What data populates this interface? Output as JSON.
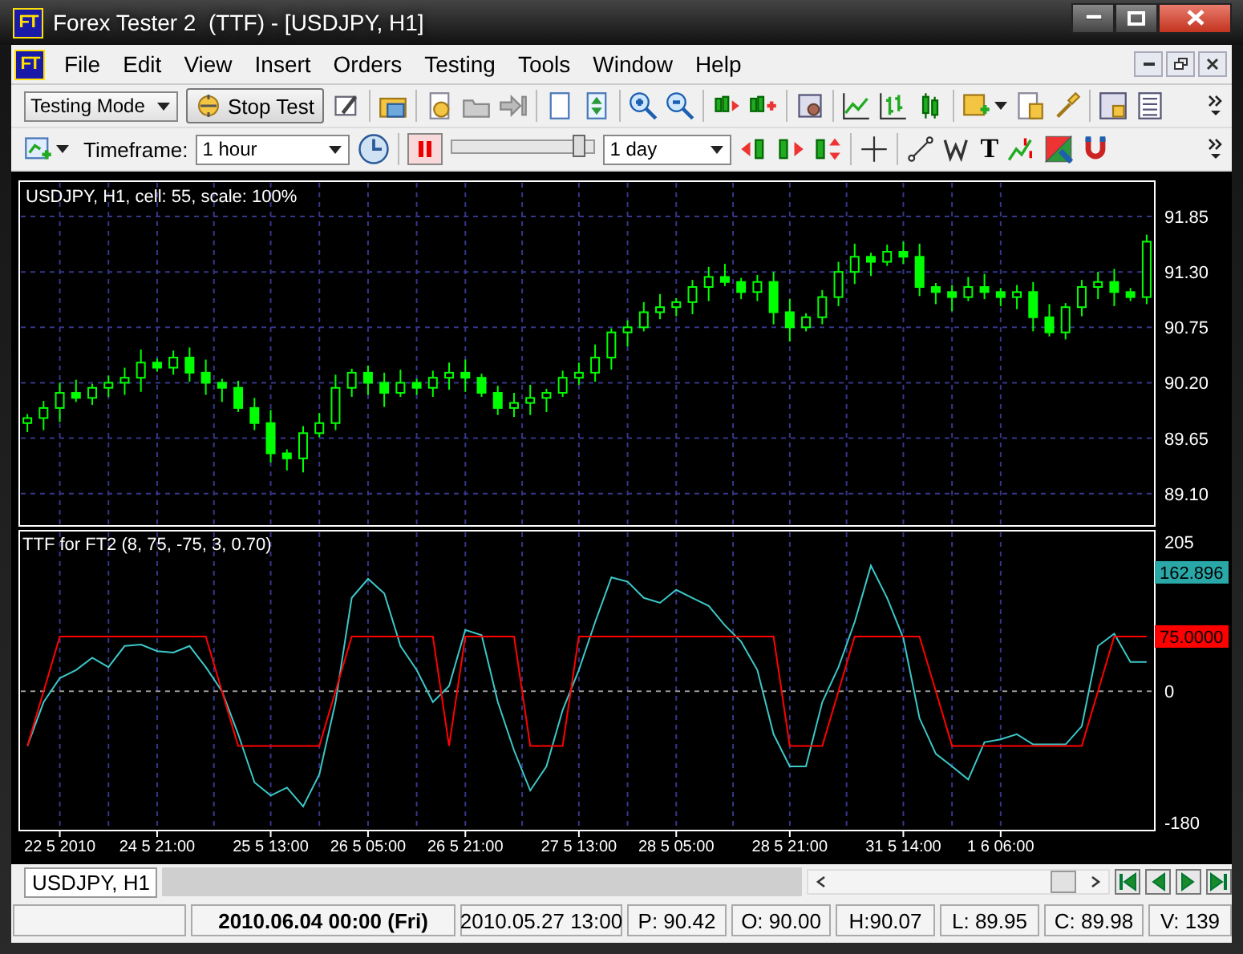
{
  "title_bar": {
    "logo": "FT",
    "title": "Forex Tester 2  (TTF) - [USDJPY, H1]"
  },
  "menu_bar": {
    "logo": "FT",
    "items": [
      "File",
      "Edit",
      "View",
      "Insert",
      "Orders",
      "Testing",
      "Tools",
      "Window",
      "Help"
    ]
  },
  "toolbar": {
    "mode": "Testing Mode",
    "stop_button": "Stop Test"
  },
  "toolbar_2": {
    "timeframe_label": "Timeframe:",
    "timeframe": "1 hour",
    "speed": {
      "level": 0.95
    },
    "jump_period": "1 day",
    "text_tool": "T"
  },
  "price_chart": {
    "title": "USDJPY, H1, cell: 55, scale: 100%",
    "chart_data": {
      "type": "candlestick",
      "grid": true,
      "ylim": [
        88.78,
        92.2
      ],
      "yticks": [
        {
          "value": 89.1,
          "label": "89.10"
        },
        {
          "value": 89.65,
          "label": "89.65"
        },
        {
          "value": 90.2,
          "label": "90.20"
        },
        {
          "value": 90.75,
          "label": "90.75"
        },
        {
          "value": 91.3,
          "label": "91.30"
        },
        {
          "value": 91.85,
          "label": "91.85"
        }
      ],
      "categories": [
        null,
        null,
        null,
        null,
        null,
        null,
        null,
        null,
        null,
        null,
        null,
        null,
        null,
        null,
        null,
        null,
        null,
        null,
        null,
        null,
        null,
        null,
        null,
        null,
        null,
        null,
        null,
        null,
        null,
        null,
        null,
        null,
        null,
        null,
        null,
        null,
        null,
        null,
        null,
        null,
        null,
        null,
        null,
        null,
        null,
        null,
        null,
        null,
        null,
        null,
        null,
        null,
        null,
        null,
        null,
        null,
        null,
        null,
        null,
        null,
        null,
        null,
        null,
        null,
        null,
        null,
        null,
        null,
        null,
        null
      ],
      "ohlc": [
        [
          89.8,
          89.89,
          89.71,
          89.85
        ],
        [
          89.85,
          90.02,
          89.73,
          89.95
        ],
        [
          89.95,
          90.2,
          89.81,
          90.1
        ],
        [
          90.1,
          90.23,
          90.01,
          90.05
        ],
        [
          90.05,
          90.19,
          89.98,
          90.15
        ],
        [
          90.15,
          90.27,
          90.06,
          90.2
        ],
        [
          90.2,
          90.35,
          90.08,
          90.25
        ],
        [
          90.25,
          90.53,
          90.11,
          90.4
        ],
        [
          90.4,
          90.44,
          90.31,
          90.35
        ],
        [
          90.35,
          90.52,
          90.28,
          90.45
        ],
        [
          90.45,
          90.55,
          90.21,
          90.3
        ],
        [
          90.3,
          90.43,
          90.08,
          90.2
        ],
        [
          90.2,
          90.24,
          90.01,
          90.15
        ],
        [
          90.15,
          90.22,
          89.91,
          89.95
        ],
        [
          89.95,
          90.05,
          89.73,
          89.8
        ],
        [
          89.8,
          89.93,
          89.41,
          89.5
        ],
        [
          89.5,
          89.54,
          89.33,
          89.45
        ],
        [
          89.45,
          89.77,
          89.31,
          89.7
        ],
        [
          89.7,
          89.9,
          89.66,
          89.8
        ],
        [
          89.8,
          90.28,
          89.73,
          90.15
        ],
        [
          90.15,
          90.34,
          90.06,
          90.3
        ],
        [
          90.3,
          90.37,
          90.08,
          90.2
        ],
        [
          90.2,
          90.3,
          89.96,
          90.1
        ],
        [
          90.1,
          90.33,
          90.06,
          90.2
        ],
        [
          90.2,
          90.24,
          90.08,
          90.15
        ],
        [
          90.15,
          90.32,
          90.06,
          90.25
        ],
        [
          90.25,
          90.4,
          90.13,
          90.3
        ],
        [
          90.3,
          90.43,
          90.11,
          90.25
        ],
        [
          90.25,
          90.29,
          90.06,
          90.1
        ],
        [
          90.1,
          90.17,
          89.88,
          89.95
        ],
        [
          89.95,
          90.1,
          89.86,
          90.0
        ],
        [
          90.0,
          90.18,
          89.88,
          90.05
        ],
        [
          90.05,
          90.14,
          89.91,
          90.1
        ],
        [
          90.1,
          90.32,
          90.06,
          90.25
        ],
        [
          90.25,
          90.4,
          90.18,
          90.3
        ],
        [
          90.3,
          90.58,
          90.21,
          90.45
        ],
        [
          90.45,
          90.74,
          90.33,
          90.7
        ],
        [
          90.7,
          90.82,
          90.56,
          90.75
        ],
        [
          90.75,
          91.0,
          90.71,
          90.9
        ],
        [
          90.9,
          91.08,
          90.83,
          90.95
        ],
        [
          90.95,
          91.04,
          90.86,
          91.0
        ],
        [
          91.0,
          91.22,
          90.88,
          91.15
        ],
        [
          91.15,
          91.35,
          91.01,
          91.25
        ],
        [
          91.25,
          91.38,
          91.16,
          91.2
        ],
        [
          91.2,
          91.24,
          91.03,
          91.1
        ],
        [
          91.1,
          91.27,
          91.01,
          91.2
        ],
        [
          91.2,
          91.3,
          90.78,
          90.9
        ],
        [
          90.9,
          91.03,
          90.61,
          90.75
        ],
        [
          90.75,
          90.89,
          90.71,
          90.85
        ],
        [
          90.85,
          91.12,
          90.78,
          91.05
        ],
        [
          91.05,
          91.4,
          90.96,
          91.3
        ],
        [
          91.3,
          91.58,
          91.18,
          91.45
        ],
        [
          91.45,
          91.49,
          91.26,
          91.4
        ],
        [
          91.4,
          91.57,
          91.36,
          91.5
        ],
        [
          91.5,
          91.6,
          91.38,
          91.45
        ],
        [
          91.45,
          91.58,
          91.06,
          91.15
        ],
        [
          91.15,
          91.19,
          90.98,
          91.1
        ],
        [
          91.1,
          91.17,
          90.91,
          91.05
        ],
        [
          91.05,
          91.25,
          91.01,
          91.15
        ],
        [
          91.15,
          91.28,
          91.03,
          91.1
        ],
        [
          91.1,
          91.14,
          90.96,
          91.05
        ],
        [
          91.05,
          91.17,
          90.93,
          91.1
        ],
        [
          91.1,
          91.2,
          90.71,
          90.85
        ],
        [
          90.85,
          90.98,
          90.66,
          90.7
        ],
        [
          90.7,
          90.99,
          90.63,
          90.95
        ],
        [
          90.95,
          91.22,
          90.86,
          91.15
        ],
        [
          91.15,
          91.3,
          91.03,
          91.2
        ],
        [
          91.2,
          91.33,
          90.96,
          91.1
        ],
        [
          91.1,
          91.14,
          91.01,
          91.05
        ],
        [
          91.05,
          91.67,
          90.98,
          91.6
        ]
      ]
    }
  },
  "indicator_chart": {
    "title": "TTF for FT2 (8, 75, -75, 3, 0.70)",
    "chart_data": {
      "type": "line",
      "grid": true,
      "ylim": [
        -191,
        220
      ],
      "yticks": [
        -180,
        0,
        205
      ],
      "categories": [
        null,
        null,
        "22 5 2010",
        null,
        null,
        null,
        null,
        null,
        "24 5 21:00",
        null,
        null,
        null,
        null,
        null,
        null,
        "25 5 13:00",
        null,
        null,
        null,
        null,
        null,
        "26 5 05:00",
        null,
        null,
        null,
        null,
        null,
        "26 5 21:00",
        null,
        null,
        null,
        null,
        null,
        null,
        "27 5 13:00",
        null,
        null,
        null,
        null,
        null,
        "28 5 05:00",
        null,
        null,
        null,
        null,
        null,
        null,
        "28 5 21:00",
        null,
        null,
        null,
        null,
        null,
        null,
        "31 5 14:00",
        null,
        null,
        null,
        null,
        null,
        "1 6 06:00",
        null,
        null,
        null,
        null,
        null,
        null,
        null,
        null,
        null
      ],
      "series": [
        {
          "color": "#3cc8c8",
          "values": [
            -75,
            -15,
            18,
            29,
            46,
            33,
            62,
            64,
            55,
            53,
            62,
            33,
            0,
            -59,
            -125,
            -143,
            -132,
            -158,
            -114,
            -15,
            128,
            154,
            134,
            62,
            29,
            -15,
            7,
            84,
            77,
            -15,
            -81,
            -136,
            -103,
            -26,
            29,
            95,
            156,
            150,
            128,
            121,
            139,
            128,
            117,
            90,
            68,
            29,
            -59,
            -103,
            -103,
            -15,
            33,
            95,
            172,
            128,
            73,
            -37,
            -86,
            -103,
            -121,
            -70,
            -66,
            -59,
            -73,
            -73,
            -73,
            -48,
            62,
            79,
            40,
            40
          ]
        },
        {
          "color": "#ff0000",
          "values": [
            -75,
            0,
            75,
            75,
            75,
            75,
            75,
            75,
            75,
            75,
            75,
            75,
            0,
            -75,
            -75,
            -75,
            -75,
            -75,
            -75,
            0,
            75,
            75,
            75,
            75,
            75,
            75,
            -75,
            75,
            75,
            75,
            75,
            -75,
            -75,
            -75,
            75,
            75,
            75,
            75,
            75,
            75,
            75,
            75,
            75,
            75,
            75,
            75,
            75,
            -75,
            -75,
            -75,
            0,
            75,
            75,
            75,
            75,
            75,
            0,
            -75,
            -75,
            -75,
            -75,
            -75,
            -75,
            -75,
            -75,
            -75,
            0,
            75,
            75,
            75
          ]
        }
      ],
      "ref_lines": [
        {
          "axis": "y",
          "value": 0
        }
      ],
      "annotations": [
        "162.896",
        "75.0000"
      ]
    }
  },
  "tabs": [
    {
      "label": "USDJPY, H1",
      "selected": true
    }
  ],
  "status_bar": [
    {
      "text": "2010.06.04 00:00 (Fri)",
      "bold": true
    },
    {
      "text": "2010.05.27 13:00",
      "bold": false
    },
    {
      "text": "P: 90.42",
      "bold": false
    },
    {
      "text": "O: 90.00",
      "bold": false
    },
    {
      "text": "H:90.07",
      "bold": false
    },
    {
      "text": "L: 89.95",
      "bold": false
    },
    {
      "text": "C: 89.98",
      "bold": false
    },
    {
      "text": "V: 139",
      "bold": false
    }
  ]
}
